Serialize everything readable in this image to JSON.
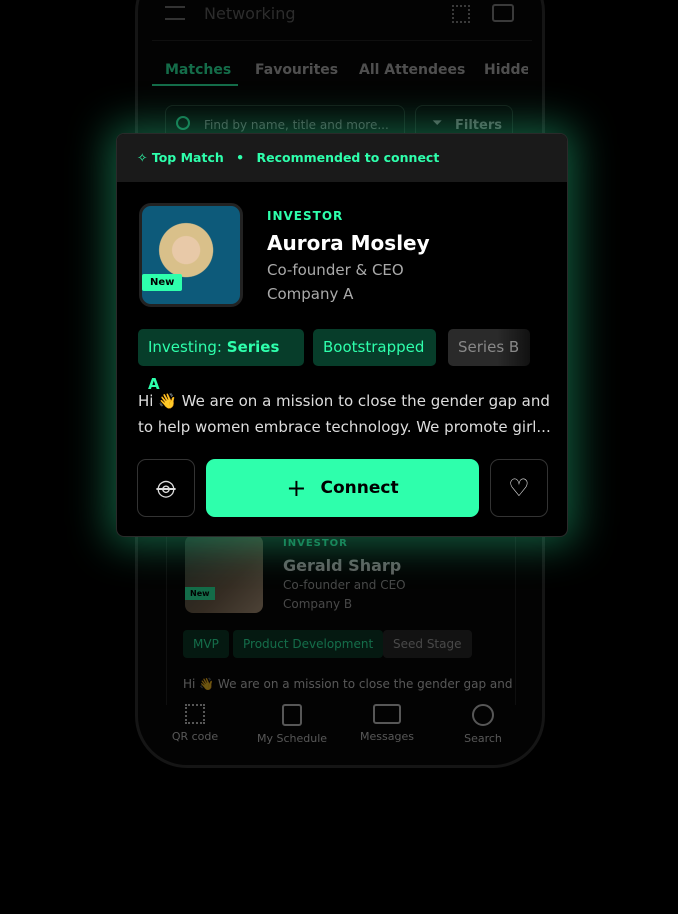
{
  "accent": "#2effac",
  "header": {
    "title": "Networking",
    "icons": [
      "menu-icon",
      "qr-code-icon",
      "chat-icon"
    ]
  },
  "tabs": [
    {
      "label": "Matches",
      "active": true
    },
    {
      "label": "Favourites"
    },
    {
      "label": "All Attendees"
    },
    {
      "label": "Hidden"
    }
  ],
  "search": {
    "placeholder": "Find by name, title and more...",
    "filters_label": "Filters"
  },
  "top_card": {
    "badge": "Top Match",
    "subtitle": "Recommended to connect",
    "role": "INVESTOR",
    "name": "Aurora Mosley",
    "title": "Co-founder & CEO",
    "company": "Company A",
    "new_label": "New",
    "tags": [
      {
        "prefix": "Investing:",
        "label": "Series A"
      },
      {
        "label": "Bootstrapped"
      },
      {
        "label": "Series B"
      }
    ],
    "bio": "Hi 👋  We are on a mission to close the gender gap and to help women embrace technology. We promote girl...",
    "connect_label": "Connect"
  },
  "second_card": {
    "role": "INVESTOR",
    "name": "Gerald Sharp",
    "title": "Co-founder and CEO",
    "company": "Company B",
    "new_label": "New",
    "tags": [
      "MVP",
      "Product Development",
      "Seed Stage"
    ],
    "bio": "Hi 👋  We are on a mission to close the gender gap and"
  },
  "bottom_nav": [
    {
      "label": "QR code",
      "icon": "qr-code-icon"
    },
    {
      "label": "My Schedule",
      "icon": "calendar-icon"
    },
    {
      "label": "Messages",
      "icon": "messages-icon"
    },
    {
      "label": "Search",
      "icon": "search-icon"
    }
  ]
}
